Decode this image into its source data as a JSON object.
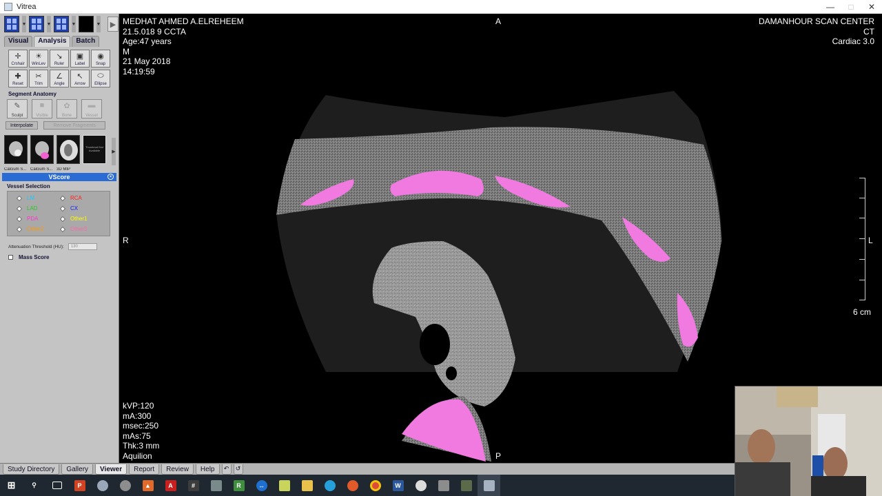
{
  "window": {
    "title": "Vitrea"
  },
  "left_panel": {
    "tabs": [
      "Visual",
      "Analysis",
      "Batch"
    ],
    "active_tab": "Analysis",
    "tools": [
      "Crshair",
      "WinLev",
      "Ruler",
      "Label",
      "Snap",
      "Reset",
      "Trim",
      "Angle",
      "Arrow",
      "Ellipse"
    ],
    "segment_title": "Segment Anatomy",
    "segment_buttons": [
      "Sculpt",
      "Visible",
      "Bone",
      "Vessel"
    ],
    "interpolate": "Interpolate",
    "remove_fragments": "Remove Fragments",
    "thumbnails": [
      "Calcium S...",
      "Calcium S...",
      "3D MIP",
      ""
    ],
    "thumbnail_not_available": "Thumbnail Not Available",
    "vscore_title": "VScore",
    "vessel_selection_title": "Vessel Selection",
    "vessels": [
      {
        "label": "LM",
        "color": "#1ec8ff"
      },
      {
        "label": "RCA",
        "color": "#ff2020"
      },
      {
        "label": "LAD",
        "color": "#22cc22"
      },
      {
        "label": "CX",
        "color": "#1020ff"
      },
      {
        "label": "PDA",
        "color": "#ff33cc"
      },
      {
        "label": "Other1",
        "color": "#ffff00"
      },
      {
        "label": "Other2",
        "color": "#ff9900"
      },
      {
        "label": "Other3",
        "color": "#ff66aa"
      }
    ],
    "attenuation_label": "Attenuation Threshold (HU):",
    "attenuation_value": "130",
    "mass_score_label": "Mass Score"
  },
  "viewer": {
    "patient_name": "MEDHAT AHMED A.ELREHEEM",
    "study_line": "21.5.018  9 CCTA",
    "age": "Age:47 years",
    "sex": "M",
    "date": "21 May 2018",
    "time": "14:19:59",
    "orientation_top": "A",
    "orientation_left": "R",
    "orientation_right": "L",
    "orientation_bottom": "P",
    "center": "DAMANHOUR SCAN CENTER",
    "modality": "CT",
    "protocol": "Cardiac 3.0",
    "scale_label": "6 cm",
    "kvp": "kVP:120",
    "ma": "mA:300",
    "msec": "msec:250",
    "mas": "mAs:75",
    "thickness": "Thk:3 mm",
    "scanner": "Aquilion"
  },
  "bottom_tabs": [
    "Study Directory",
    "Gallery",
    "Viewer",
    "Report",
    "Review",
    "Help"
  ],
  "active_bottom_tab": "Viewer",
  "taskbar": {
    "items": [
      "start-icon",
      "search-icon",
      "task-view-icon",
      "powerpoint-icon",
      "chrome-alt-icon",
      "settings-icon",
      "matlab-icon",
      "acrobat-icon",
      "calculator-icon",
      "app-icon",
      "rstudio-icon",
      "teamviewer-icon",
      "notepad-icon",
      "folder-icon",
      "network-icon",
      "gear-icon",
      "chrome-icon",
      "word-icon",
      "disk-icon",
      "media-icon",
      "editor-icon",
      "vitrea-icon"
    ]
  }
}
